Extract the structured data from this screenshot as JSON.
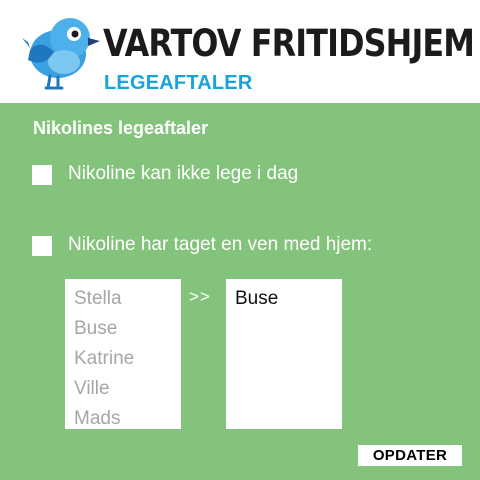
{
  "header": {
    "logo_icon": "bird-icon",
    "title": "VARTOV FRITIDSHJEM",
    "subtitle": "LEGEAFTALER",
    "subtitle_color": "#18a3dc"
  },
  "panel": {
    "background_color": "#84c37b",
    "section_title": "Nikolines legeaftaler",
    "options": [
      {
        "label": "Nikoline kan ikke lege i dag",
        "checked": false
      },
      {
        "label": "Nikoline har taget en ven med hjem:",
        "checked": false
      }
    ],
    "available_friends": [
      "Stella",
      "Buse",
      "Katrine",
      "Ville",
      "Mads"
    ],
    "move_button_label": ">>",
    "selected_friends": [
      "Buse"
    ],
    "update_button_label": "OPDATER"
  }
}
